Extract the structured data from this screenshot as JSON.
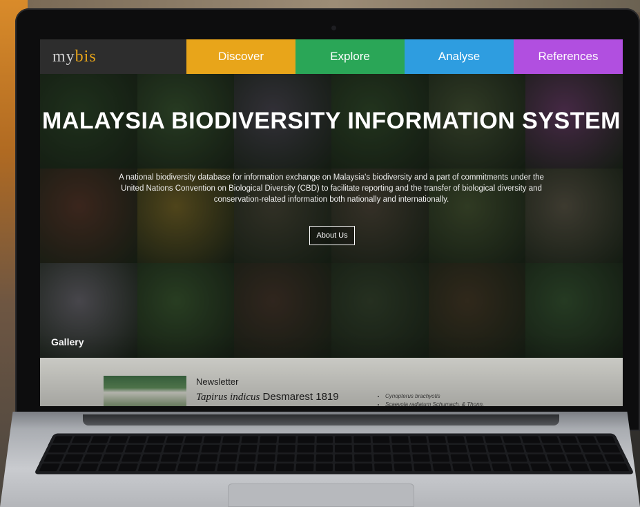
{
  "site": {
    "logo_prefix": "my",
    "logo_accent": "bis"
  },
  "nav": [
    {
      "label": "Discover",
      "color": "#e8a51a"
    },
    {
      "label": "Explore",
      "color": "#2aa657"
    },
    {
      "label": "Analyse",
      "color": "#2e9de0"
    },
    {
      "label": "References",
      "color": "#b14fe0"
    }
  ],
  "hero": {
    "title": "MALAYSIA BIODIVERSITY INFORMATION SYSTEM",
    "description": "A national biodiversity database for information exchange on Malaysia's biodiversity and a part of commitments under the United Nations Convention on Biological Diversity (CBD) to facilitate reporting and the transfer of biological diversity and conservation-related information both nationally and internationally.",
    "about_button": "About Us",
    "gallery_label": "Gallery"
  },
  "newsletter": {
    "heading": "Newsletter",
    "species_italic": "Tapirus indicus",
    "species_authority": " Desmarest 1819"
  },
  "list_items": [
    "Cynopterus brachyotis",
    "Scaevola radiatum Schumach. & Thonn."
  ],
  "tile_colors": [
    "#2f4a2b",
    "#3c5a34",
    "#4d4a55",
    "#35502e",
    "#4a5a3a",
    "#6b3f6a",
    "#5a3a2c",
    "#7a6a2a",
    "#4b4a3a",
    "#514a3c",
    "#4a5a36",
    "#5e5a4a",
    "#6e6c74",
    "#3e5e34",
    "#4a3a2e",
    "#3a4a32",
    "#4a3e2a",
    "#3a5a36"
  ]
}
